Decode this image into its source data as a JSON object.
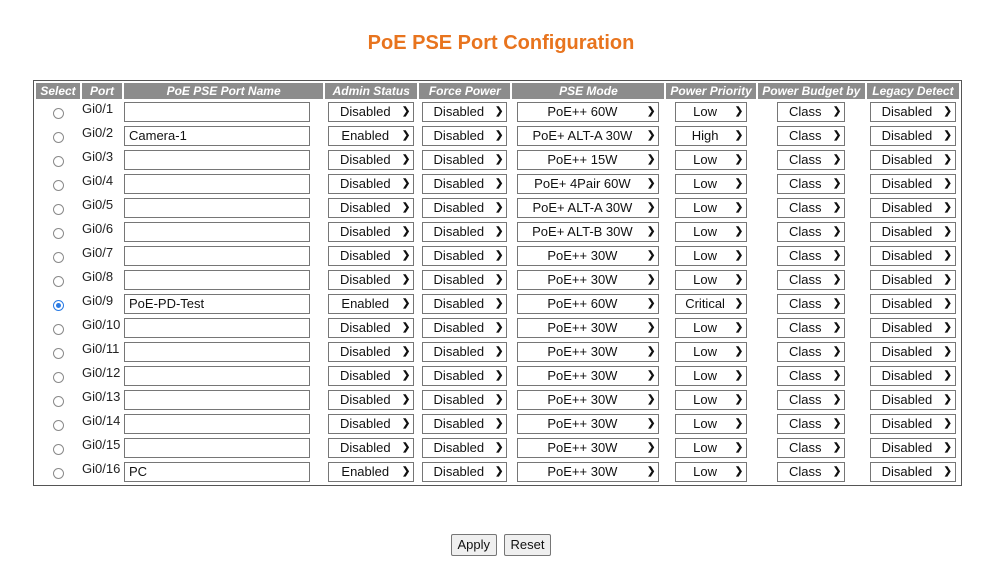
{
  "page": {
    "title": "PoE PSE Port Configuration"
  },
  "columns": {
    "select": "Select",
    "port": "Port",
    "name": "PoE PSE Port Name",
    "admin": "Admin Status",
    "force": "Force Power",
    "mode": "PSE Mode",
    "priority": "Power Priority",
    "budget": "Power Budget by",
    "legacy": "Legacy Detect"
  },
  "rows": [
    {
      "selected": false,
      "port": "Gi0/1",
      "name": "",
      "admin": "Disabled",
      "force": "Disabled",
      "mode": "PoE++ 60W",
      "priority": "Low",
      "budget": "Class",
      "legacy": "Disabled"
    },
    {
      "selected": false,
      "port": "Gi0/2",
      "name": "Camera-1",
      "admin": "Enabled",
      "force": "Disabled",
      "mode": "PoE+ ALT-A 30W",
      "priority": "High",
      "budget": "Class",
      "legacy": "Disabled"
    },
    {
      "selected": false,
      "port": "Gi0/3",
      "name": "",
      "admin": "Disabled",
      "force": "Disabled",
      "mode": "PoE++ 15W",
      "priority": "Low",
      "budget": "Class",
      "legacy": "Disabled"
    },
    {
      "selected": false,
      "port": "Gi0/4",
      "name": "",
      "admin": "Disabled",
      "force": "Disabled",
      "mode": "PoE+ 4Pair 60W",
      "priority": "Low",
      "budget": "Class",
      "legacy": "Disabled"
    },
    {
      "selected": false,
      "port": "Gi0/5",
      "name": "",
      "admin": "Disabled",
      "force": "Disabled",
      "mode": "PoE+ ALT-A 30W",
      "priority": "Low",
      "budget": "Class",
      "legacy": "Disabled"
    },
    {
      "selected": false,
      "port": "Gi0/6",
      "name": "",
      "admin": "Disabled",
      "force": "Disabled",
      "mode": "PoE+ ALT-B 30W",
      "priority": "Low",
      "budget": "Class",
      "legacy": "Disabled"
    },
    {
      "selected": false,
      "port": "Gi0/7",
      "name": "",
      "admin": "Disabled",
      "force": "Disabled",
      "mode": "PoE++ 30W",
      "priority": "Low",
      "budget": "Class",
      "legacy": "Disabled"
    },
    {
      "selected": false,
      "port": "Gi0/8",
      "name": "",
      "admin": "Disabled",
      "force": "Disabled",
      "mode": "PoE++ 30W",
      "priority": "Low",
      "budget": "Class",
      "legacy": "Disabled"
    },
    {
      "selected": true,
      "port": "Gi0/9",
      "name": "PoE-PD-Test",
      "admin": "Enabled",
      "force": "Disabled",
      "mode": "PoE++ 60W",
      "priority": "Critical",
      "budget": "Class",
      "legacy": "Disabled"
    },
    {
      "selected": false,
      "port": "Gi0/10",
      "name": "",
      "admin": "Disabled",
      "force": "Disabled",
      "mode": "PoE++ 30W",
      "priority": "Low",
      "budget": "Class",
      "legacy": "Disabled"
    },
    {
      "selected": false,
      "port": "Gi0/11",
      "name": "",
      "admin": "Disabled",
      "force": "Disabled",
      "mode": "PoE++ 30W",
      "priority": "Low",
      "budget": "Class",
      "legacy": "Disabled"
    },
    {
      "selected": false,
      "port": "Gi0/12",
      "name": "",
      "admin": "Disabled",
      "force": "Disabled",
      "mode": "PoE++ 30W",
      "priority": "Low",
      "budget": "Class",
      "legacy": "Disabled"
    },
    {
      "selected": false,
      "port": "Gi0/13",
      "name": "",
      "admin": "Disabled",
      "force": "Disabled",
      "mode": "PoE++ 30W",
      "priority": "Low",
      "budget": "Class",
      "legacy": "Disabled"
    },
    {
      "selected": false,
      "port": "Gi0/14",
      "name": "",
      "admin": "Disabled",
      "force": "Disabled",
      "mode": "PoE++ 30W",
      "priority": "Low",
      "budget": "Class",
      "legacy": "Disabled"
    },
    {
      "selected": false,
      "port": "Gi0/15",
      "name": "",
      "admin": "Disabled",
      "force": "Disabled",
      "mode": "PoE++ 30W",
      "priority": "Low",
      "budget": "Class",
      "legacy": "Disabled"
    },
    {
      "selected": false,
      "port": "Gi0/16",
      "name": "PC",
      "admin": "Enabled",
      "force": "Disabled",
      "mode": "PoE++ 30W",
      "priority": "Low",
      "budget": "Class",
      "legacy": "Disabled"
    }
  ],
  "buttons": {
    "apply": "Apply",
    "reset": "Reset"
  },
  "icons": {
    "select_arrow": "chevron-down-icon"
  },
  "colors": {
    "title": "#e8741e",
    "header_bg": "#8c8c8c",
    "radio_selected": "#2a7be4"
  }
}
